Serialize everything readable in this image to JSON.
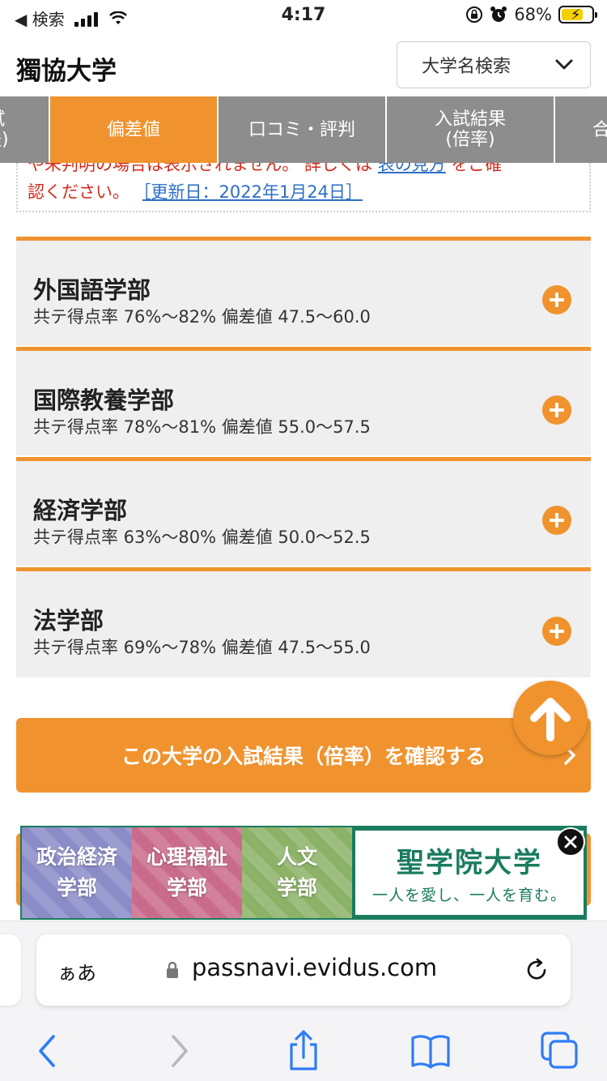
{
  "status_bar": {
    "back_label": "◀ 検索",
    "time": "4:17",
    "battery_percent": "68%"
  },
  "header": {
    "title": "獨協大学",
    "search_label": "大学名検索"
  },
  "tabs": [
    {
      "line1": "試",
      "line2": "程)"
    },
    {
      "label": "偏差値"
    },
    {
      "label": "口コミ・評判"
    },
    {
      "line1": "入試結果",
      "line2": "(倍率)"
    },
    {
      "label": "合"
    }
  ],
  "notice": {
    "line1_text": "や未判明の場合は表示されません。 詳しくは",
    "line1_link": "表の見方",
    "line1_tail": "をご確",
    "line2_text": "認ください。",
    "updated": "［更新日：2022年1月24日］"
  },
  "faculties": [
    {
      "name": "外国語学部",
      "stats": "共テ得点率 76%〜82% 偏差値 47.5〜60.0"
    },
    {
      "name": "国際教養学部",
      "stats": "共テ得点率 78%〜81% 偏差値 55.0〜57.5"
    },
    {
      "name": "経済学部",
      "stats": "共テ得点率 63%〜80% 偏差値 50.0〜52.5"
    },
    {
      "name": "法学部",
      "stats": "共テ得点率 69%〜78% 偏差値 47.5〜55.0"
    }
  ],
  "cta": {
    "label": "この大学の入試結果（倍率）を確認する"
  },
  "ad": {
    "tile1": [
      "政治経済",
      "学部"
    ],
    "tile2": [
      "心理福祉",
      "学部"
    ],
    "tile3": [
      "人文",
      "学部"
    ],
    "brand": "聖学院大学",
    "tagline": "一人を愛し、一人を育む。"
  },
  "browser": {
    "aa": "ぁあ",
    "url": "passnavi.evidus.com"
  },
  "colors": {
    "accent": "#f0932e",
    "tab_gray": "#8d8d8d",
    "link": "#2d6fc7",
    "notice_red": "#d62b1b"
  },
  "icons": [
    "chevron-down-icon",
    "plus-icon",
    "arrow-up-icon",
    "close-icon",
    "lock-icon",
    "reload-icon",
    "back-icon",
    "forward-icon",
    "share-icon",
    "bookmarks-icon",
    "tabs-icon"
  ]
}
